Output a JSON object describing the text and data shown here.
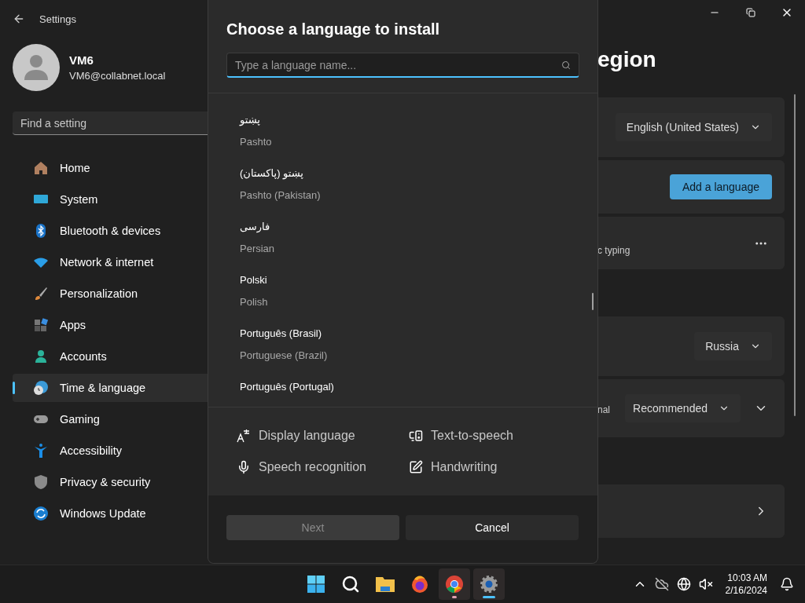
{
  "window": {
    "title": "Settings"
  },
  "account": {
    "name": "VM6",
    "email": "VM6@collabnet.local"
  },
  "search": {
    "placeholder": "Find a setting"
  },
  "nav": [
    {
      "label": "Home",
      "selected": false
    },
    {
      "label": "System",
      "selected": false
    },
    {
      "label": "Bluetooth & devices",
      "selected": false
    },
    {
      "label": "Network & internet",
      "selected": false
    },
    {
      "label": "Personalization",
      "selected": false
    },
    {
      "label": "Apps",
      "selected": false
    },
    {
      "label": "Accounts",
      "selected": false
    },
    {
      "label": "Time & language",
      "selected": true
    },
    {
      "label": "Gaming",
      "selected": false
    },
    {
      "label": "Accessibility",
      "selected": false
    },
    {
      "label": "Privacy & security",
      "selected": false
    },
    {
      "label": "Windows Update",
      "selected": false
    }
  ],
  "page": {
    "heading": "egion",
    "cards": [
      {
        "kind": "dropdown",
        "value": "English (United States)"
      },
      {
        "kind": "button",
        "label": "Add a language"
      },
      {
        "kind": "more",
        "text": "c typing"
      },
      {
        "kind": "dropdown",
        "value": "Russia",
        "gap": true
      },
      {
        "kind": "dropdown-expand",
        "text": "nal",
        "value": "Recommended"
      },
      {
        "kind": "link",
        "gap": true
      }
    ]
  },
  "dialog": {
    "title": "Choose a language to install",
    "search": {
      "placeholder": "Type a language name..."
    },
    "languages": [
      {
        "native": "پښتو",
        "english": "Pashto"
      },
      {
        "native": "پښتو (پاکستان)",
        "english": "Pashto (Pakistan)"
      },
      {
        "native": "فارسی",
        "english": "Persian"
      },
      {
        "native": "Polski",
        "english": "Polish"
      },
      {
        "native": "Português (Brasil)",
        "english": "Portuguese (Brazil)"
      },
      {
        "native": "Português (Portugal)"
      }
    ],
    "features": [
      {
        "label": "Display language"
      },
      {
        "label": "Text-to-speech"
      },
      {
        "label": "Speech recognition"
      },
      {
        "label": "Handwriting"
      }
    ],
    "buttons": [
      {
        "label": "Next",
        "disabled": true
      },
      {
        "label": "Cancel",
        "disabled": false
      }
    ]
  },
  "taskbar": {
    "apps": [
      {
        "running": false,
        "selected": false
      },
      {
        "running": false,
        "selected": false
      },
      {
        "running": false,
        "selected": false
      },
      {
        "running": false,
        "selected": false
      },
      {
        "running": true,
        "selected": false
      },
      {
        "running": true,
        "selected": true
      }
    ],
    "time": "10:03 AM",
    "date": "2/16/2024"
  }
}
